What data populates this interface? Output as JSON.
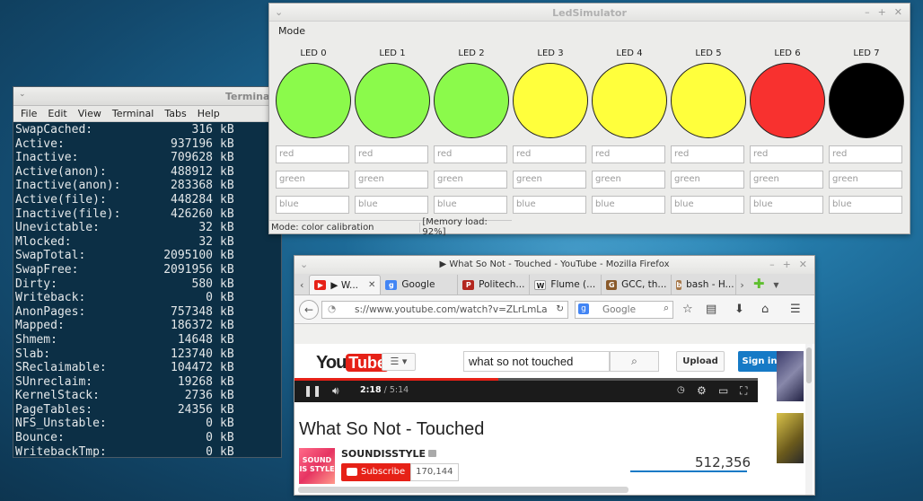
{
  "terminal": {
    "title": "Terminal",
    "menu": [
      "File",
      "Edit",
      "View",
      "Terminal",
      "Tabs",
      "Help"
    ],
    "rows": [
      {
        "key": "SwapCached:",
        "value": "316",
        "unit": "kB"
      },
      {
        "key": "Active:",
        "value": "937196",
        "unit": "kB"
      },
      {
        "key": "Inactive:",
        "value": "709628",
        "unit": "kB"
      },
      {
        "key": "Active(anon):",
        "value": "488912",
        "unit": "kB"
      },
      {
        "key": "Inactive(anon):",
        "value": "283368",
        "unit": "kB"
      },
      {
        "key": "Active(file):",
        "value": "448284",
        "unit": "kB"
      },
      {
        "key": "Inactive(file):",
        "value": "426260",
        "unit": "kB"
      },
      {
        "key": "Unevictable:",
        "value": "32",
        "unit": "kB"
      },
      {
        "key": "Mlocked:",
        "value": "32",
        "unit": "kB"
      },
      {
        "key": "SwapTotal:",
        "value": "2095100",
        "unit": "kB"
      },
      {
        "key": "SwapFree:",
        "value": "2091956",
        "unit": "kB"
      },
      {
        "key": "Dirty:",
        "value": "580",
        "unit": "kB"
      },
      {
        "key": "Writeback:",
        "value": "0",
        "unit": "kB"
      },
      {
        "key": "AnonPages:",
        "value": "757348",
        "unit": "kB"
      },
      {
        "key": "Mapped:",
        "value": "186372",
        "unit": "kB"
      },
      {
        "key": "Shmem:",
        "value": "14648",
        "unit": "kB"
      },
      {
        "key": "Slab:",
        "value": "123740",
        "unit": "kB"
      },
      {
        "key": "SReclaimable:",
        "value": "104472",
        "unit": "kB"
      },
      {
        "key": "SUnreclaim:",
        "value": "19268",
        "unit": "kB"
      },
      {
        "key": "KernelStack:",
        "value": "2736",
        "unit": "kB"
      },
      {
        "key": "PageTables:",
        "value": "24356",
        "unit": "kB"
      },
      {
        "key": "NFS_Unstable:",
        "value": "0",
        "unit": "kB"
      },
      {
        "key": "Bounce:",
        "value": "0",
        "unit": "kB"
      },
      {
        "key": "WritebackTmp:",
        "value": "0",
        "unit": "kB"
      }
    ]
  },
  "led": {
    "title": "LedSimulator",
    "mode_label": "Mode",
    "leds": [
      {
        "label": "LED 0",
        "color": "#8bfa4b"
      },
      {
        "label": "LED 1",
        "color": "#8bfa4b"
      },
      {
        "label": "LED 2",
        "color": "#8bfa4b"
      },
      {
        "label": "LED 3",
        "color": "#ffff3c"
      },
      {
        "label": "LED 4",
        "color": "#ffff3c"
      },
      {
        "label": "LED 5",
        "color": "#ffff3c"
      },
      {
        "label": "LED 6",
        "color": "#f8312f"
      },
      {
        "label": "LED 7",
        "color": "#000000"
      }
    ],
    "placeholders": {
      "red": "red",
      "green": "green",
      "blue": "blue"
    },
    "status_mode": "Mode: color calibration",
    "status_memory": "[Memory load: 92%]"
  },
  "firefox": {
    "title": "▶ What So Not - Touched - YouTube - Mozilla Firefox",
    "tabs": [
      {
        "label": "▶ W...",
        "icon_color": "#e62117",
        "icon": "▶"
      },
      {
        "label": "Google",
        "icon_color": "#4285f4",
        "icon": "g"
      },
      {
        "label": "Politech...",
        "icon_color": "#b3261e",
        "icon": "P"
      },
      {
        "label": "Flume (...",
        "icon_color": "#ffffff",
        "icon": "W"
      },
      {
        "label": "GCC, th...",
        "icon_color": "#8a5a2b",
        "icon": "G"
      },
      {
        "label": "bash - H...",
        "icon_color": "#a7794b",
        "icon": "b"
      }
    ],
    "url": "s://www.youtube.com/watch?v=ZLrLmLa",
    "search_placeholder": "Google"
  },
  "youtube": {
    "logo_you": "You",
    "logo_tube": "Tube",
    "logo_region": "PL",
    "search_value": "what so not touched",
    "upload_label": "Upload",
    "signin_label": "Sign in",
    "time_current": "2:18",
    "time_total": "/ 5:14",
    "progress": 0.44,
    "video_title": "What So Not - Touched",
    "channel_name": "SOUNDISSTYLE",
    "avatar_text": "SOUND IS STYLE",
    "subscribe_label": "Subscribe",
    "subscriber_count": "170,144",
    "views": "512,356"
  },
  "colors": {
    "youtube_red": "#e62117",
    "youtube_blue": "#167ac6",
    "terminal_bg": "#0c2f45"
  }
}
